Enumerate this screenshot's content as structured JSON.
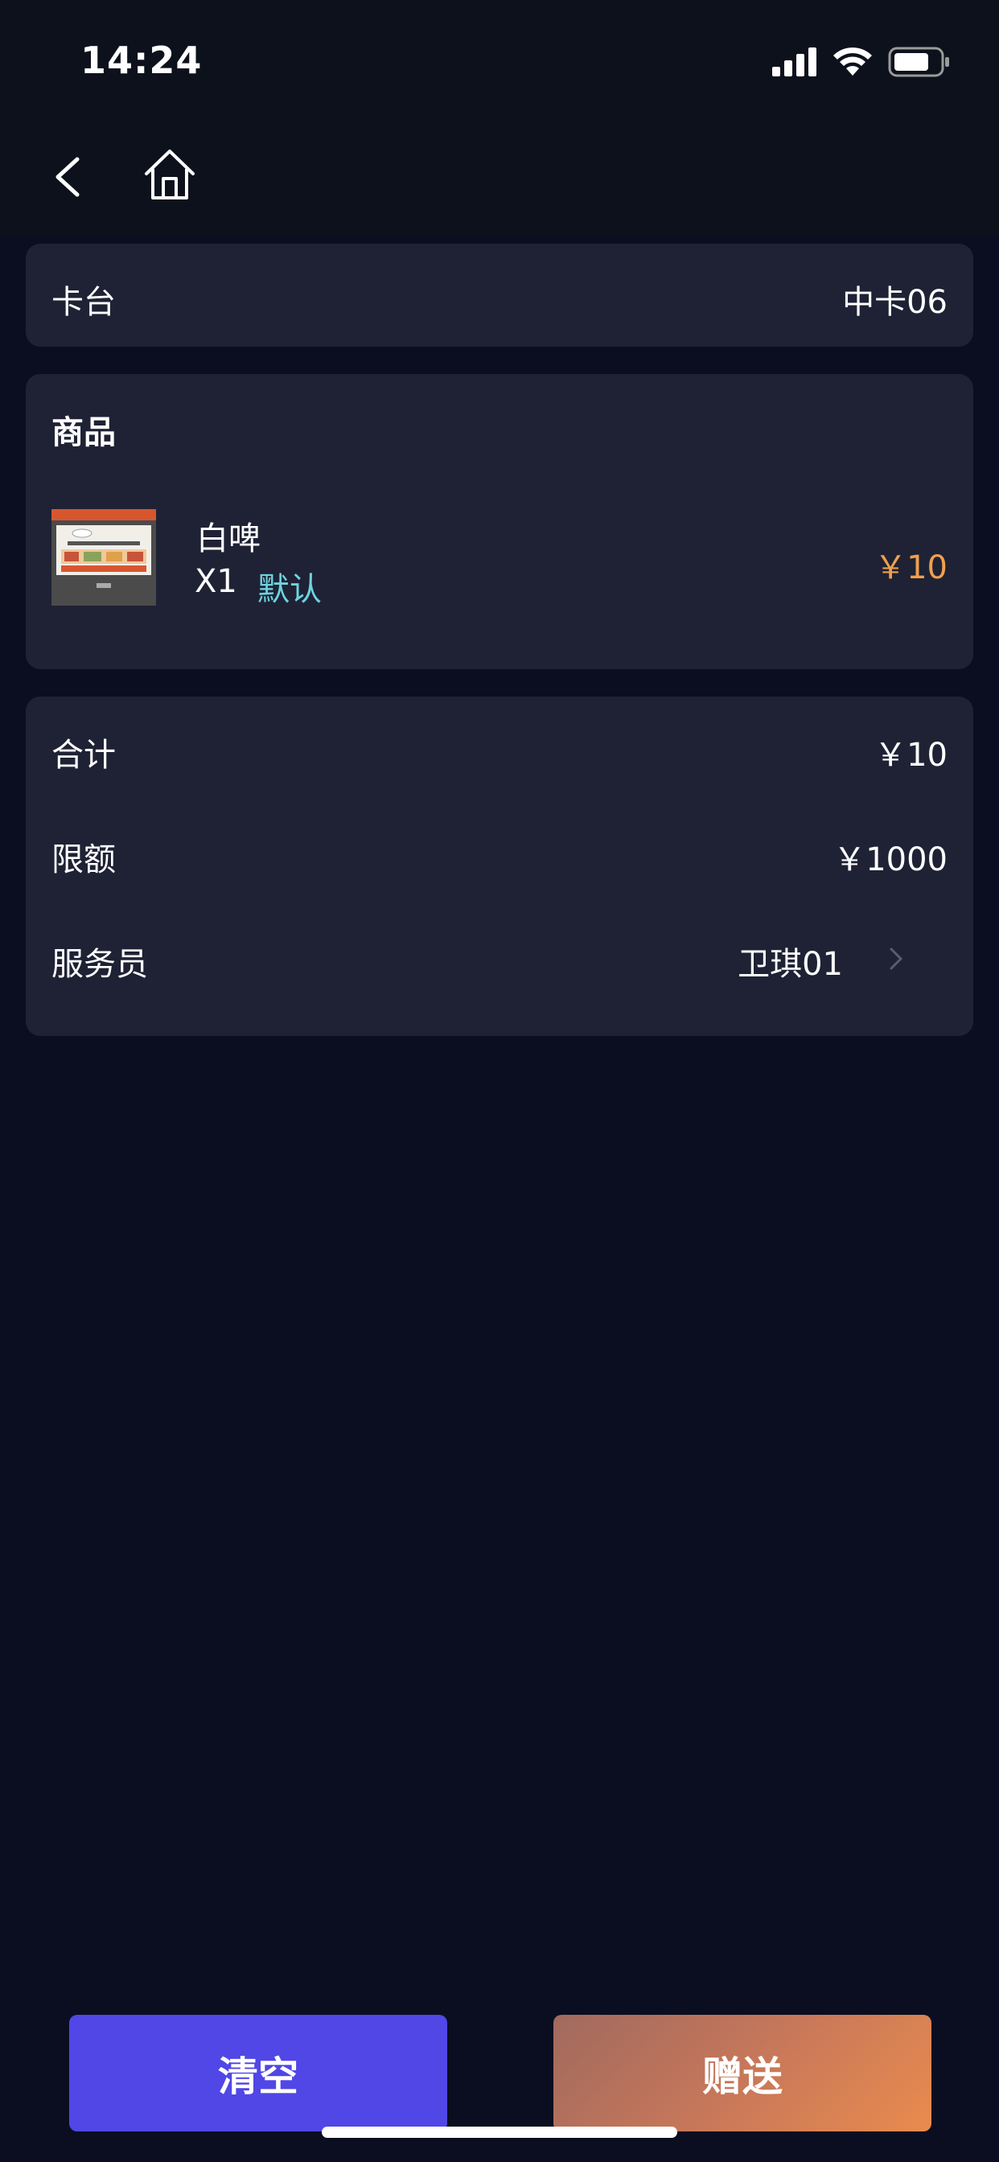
{
  "status_bar": {
    "time": "14:24"
  },
  "nav": {
    "back_icon": "chevron-left-icon",
    "home_icon": "home-icon"
  },
  "table_card": {
    "label": "卡台",
    "value": "中卡06"
  },
  "goods_card": {
    "title": "商品",
    "items": [
      {
        "name": "白啤",
        "quantity": "X1",
        "spec": "默认",
        "price": "￥10"
      }
    ]
  },
  "summary_card": {
    "total_label": "合计",
    "total_value": "￥10",
    "limit_label": "限额",
    "limit_value": "￥1000",
    "waiter_label": "服务员",
    "waiter_value": "卫琪01"
  },
  "actions": {
    "clear_label": "清空",
    "gift_label": "赠送"
  },
  "colors": {
    "background": "#0a0e20",
    "card": "#1f2234",
    "accent_price": "#f0a04c",
    "accent_spec": "#6fd3e0",
    "clear_button": "#5047e6",
    "gift_button_start": "#a06a5e",
    "gift_button_end": "#e98b4e"
  }
}
